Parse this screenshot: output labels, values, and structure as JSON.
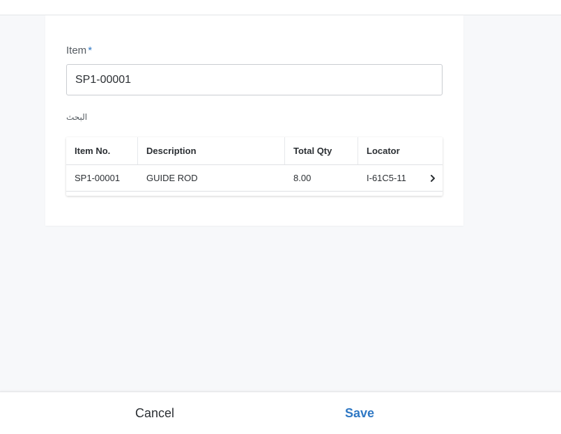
{
  "form": {
    "item_label": "Item",
    "required_marker": "*",
    "item_value": "SP1-00001",
    "search_label": "البحث"
  },
  "results_table": {
    "columns": [
      "Item No.",
      "Description",
      "Total Qty",
      "Locator"
    ],
    "rows": [
      {
        "item_no": "SP1-00001",
        "description": "GUIDE ROD",
        "total_qty": "8.00",
        "locator": "I-61C5-11",
        "action_icon": "chevron-right-icon"
      }
    ]
  },
  "footer": {
    "cancel_label": "Cancel",
    "save_label": "Save"
  },
  "colors": {
    "accent": "#2f78c4",
    "background": "#f7f8fa",
    "card": "#ffffff",
    "text": "#2b2f33"
  }
}
